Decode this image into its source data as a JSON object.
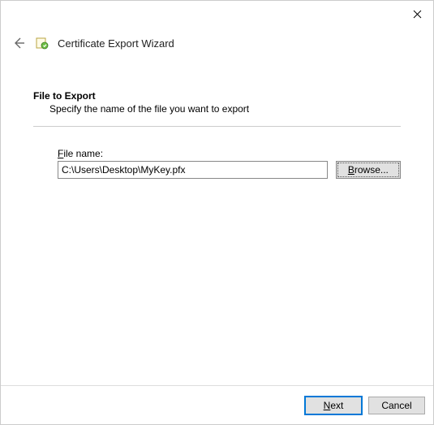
{
  "window": {
    "wizard_title": "Certificate Export Wizard"
  },
  "page": {
    "heading": "File to Export",
    "subtitle": "Specify the name of the file you want to export"
  },
  "file": {
    "label_prefix": "F",
    "label_rest": "ile name:",
    "value": "C:\\Users\\Desktop\\MyKey.pfx",
    "browse_prefix": "B",
    "browse_rest": "rowse..."
  },
  "footer": {
    "next_prefix": "N",
    "next_rest": "ext",
    "cancel": "Cancel"
  }
}
